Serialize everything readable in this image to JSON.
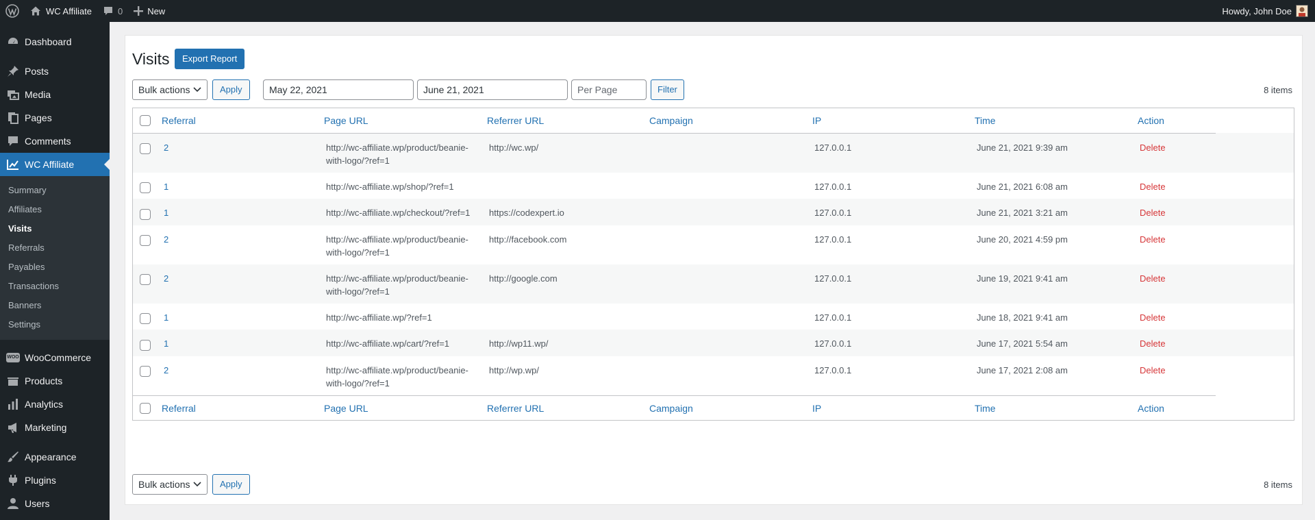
{
  "admin_bar": {
    "site_name": "WC Affiliate",
    "comments_count": "0",
    "new_label": "New",
    "greeting": "Howdy, John Doe"
  },
  "sidebar": {
    "top_items": [
      {
        "label": "Dashboard",
        "icon": "dashboard-icon"
      }
    ],
    "items": [
      {
        "label": "Posts",
        "icon": "pushpin-icon"
      },
      {
        "label": "Media",
        "icon": "media-icon"
      },
      {
        "label": "Pages",
        "icon": "pages-icon"
      },
      {
        "label": "Comments",
        "icon": "comments-icon"
      },
      {
        "label": "WC Affiliate",
        "icon": "chart-line-icon",
        "active": true
      }
    ],
    "submenu": [
      "Summary",
      "Affiliates",
      "Visits",
      "Referrals",
      "Payables",
      "Transactions",
      "Banners",
      "Settings"
    ],
    "submenu_current": "Visits",
    "bottom_items": [
      {
        "label": "WooCommerce",
        "icon": "woocommerce-icon"
      },
      {
        "label": "Products",
        "icon": "products-icon"
      },
      {
        "label": "Analytics",
        "icon": "analytics-icon"
      },
      {
        "label": "Marketing",
        "icon": "megaphone-icon"
      }
    ],
    "bottom_items_2": [
      {
        "label": "Appearance",
        "icon": "paintbrush-icon"
      },
      {
        "label": "Plugins",
        "icon": "plugins-icon"
      },
      {
        "label": "Users",
        "icon": "users-icon"
      }
    ],
    "woo_badge": "WOO"
  },
  "page": {
    "title": "Visits",
    "export_button": "Export Report",
    "bulk_actions": "Bulk actions",
    "apply": "Apply",
    "date_from": "May 22, 2021",
    "date_to": "June 21, 2021",
    "per_page_placeholder": "Per Page",
    "filter": "Filter",
    "items_count": "8 items"
  },
  "table": {
    "columns": [
      "Referral",
      "Page URL",
      "Referrer URL",
      "Campaign",
      "IP",
      "Time",
      "Action"
    ],
    "rows": [
      {
        "referral": "2",
        "page_url": "http://wc-affiliate.wp/product/beanie-with-logo/?ref=1",
        "referrer_url": "http://wc.wp/",
        "campaign": "",
        "ip": "127.0.0.1",
        "time": "June 21, 2021 9:39 am",
        "action": "Delete"
      },
      {
        "referral": "1",
        "page_url": "http://wc-affiliate.wp/shop/?ref=1",
        "referrer_url": "",
        "campaign": "",
        "ip": "127.0.0.1",
        "time": "June 21, 2021 6:08 am",
        "action": "Delete"
      },
      {
        "referral": "1",
        "page_url": "http://wc-affiliate.wp/checkout/?ref=1",
        "referrer_url": "https://codexpert.io",
        "campaign": "",
        "ip": "127.0.0.1",
        "time": "June 21, 2021 3:21 am",
        "action": "Delete"
      },
      {
        "referral": "2",
        "page_url": "http://wc-affiliate.wp/product/beanie-with-logo/?ref=1",
        "referrer_url": "http://facebook.com",
        "campaign": "",
        "ip": "127.0.0.1",
        "time": "June 20, 2021 4:59 pm",
        "action": "Delete"
      },
      {
        "referral": "2",
        "page_url": "http://wc-affiliate.wp/product/beanie-with-logo/?ref=1",
        "referrer_url": "http://google.com",
        "campaign": "",
        "ip": "127.0.0.1",
        "time": "June 19, 2021 9:41 am",
        "action": "Delete"
      },
      {
        "referral": "1",
        "page_url": "http://wc-affiliate.wp/?ref=1",
        "referrer_url": "",
        "campaign": "",
        "ip": "127.0.0.1",
        "time": "June 18, 2021 9:41 am",
        "action": "Delete"
      },
      {
        "referral": "1",
        "page_url": "http://wc-affiliate.wp/cart/?ref=1",
        "referrer_url": "http://wp11.wp/",
        "campaign": "",
        "ip": "127.0.0.1",
        "time": "June 17, 2021 5:54 am",
        "action": "Delete"
      },
      {
        "referral": "2",
        "page_url": "http://wc-affiliate.wp/product/beanie-with-logo/?ref=1",
        "referrer_url": "http://wp.wp/",
        "campaign": "",
        "ip": "127.0.0.1",
        "time": "June 17, 2021 2:08 am",
        "action": "Delete"
      }
    ]
  },
  "colors": {
    "admin_dark": "#1d2327",
    "submenu_bg": "#2c3338",
    "accent": "#2271b1",
    "delete": "#d63638",
    "page_bg": "#f0f0f1"
  }
}
